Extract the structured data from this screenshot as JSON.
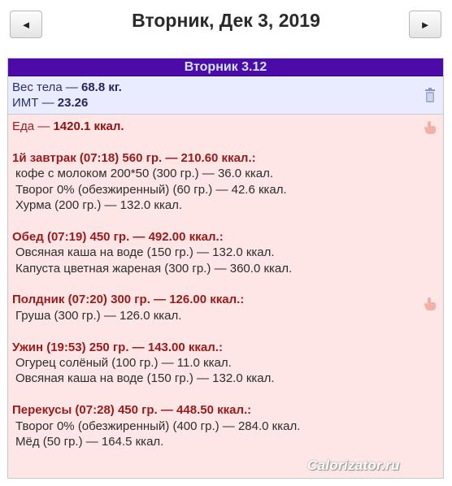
{
  "header": {
    "title": "Вторник, Дек 3, 2019",
    "prev_glyph": "◄",
    "next_glyph": "►"
  },
  "day": {
    "label": "Вторник 3.12",
    "body": {
      "weight_label": "Вес тела —",
      "weight_value": "68.8 кг.",
      "bmi_label": "ИМТ —",
      "bmi_value": "23.26"
    },
    "food_label": "Еда —",
    "food_total": "1420.1 ккал.",
    "meals": [
      {
        "title": "1й завтрак (07:18) 560 гр. — 210.60 ккал.:",
        "items": [
          "кофе с молоком 200*50 (300 гр.) — 36.0 ккал.",
          "Творог 0% (обезжиренный) (60 гр.) — 42.6 ккал.",
          "Хурма (200 гр.) — 132.0 ккал."
        ]
      },
      {
        "title": "Обед (07:19) 450 гр. — 492.00 ккал.:",
        "items": [
          "Овсяная каша на воде (150 гр.) — 132.0 ккал.",
          "Капуста цветная жареная (300 гр.) — 360.0 ккал."
        ]
      },
      {
        "title": "Полдник (07:20) 300 гр. — 126.00 ккал.:",
        "items": [
          "Груша (300 гр.) — 126.0 ккал."
        ]
      },
      {
        "title": "Ужин (19:53) 250 гр. — 143.00 ккал.:",
        "items": [
          "Огурец солёный (100 гр.) — 11.0 ккал.",
          "Овсяная каша на воде (150 гр.) — 132.0 ккал."
        ]
      },
      {
        "title": "Перекусы (07:28) 450 гр. — 448.50 ккал.:",
        "items": [
          "Творог 0% (обезжиренный) (400 гр.) — 284.0 ккал.",
          "Мёд (50 гр.) — 164.5 ккал."
        ]
      }
    ]
  },
  "watermark": "Calorizator.ru",
  "colors": {
    "day_header_bg": "#4c0ba8",
    "day_header_text": "#cfe6ff",
    "weight_bg": "#e9ecff",
    "food_bg": "#ffe6e6",
    "meal_title": "#9a1a1a"
  },
  "icons": {
    "prev": "left-triangle-icon",
    "next": "right-triangle-icon",
    "weight_action": "trash-icon",
    "food_action": "hand-icon"
  }
}
